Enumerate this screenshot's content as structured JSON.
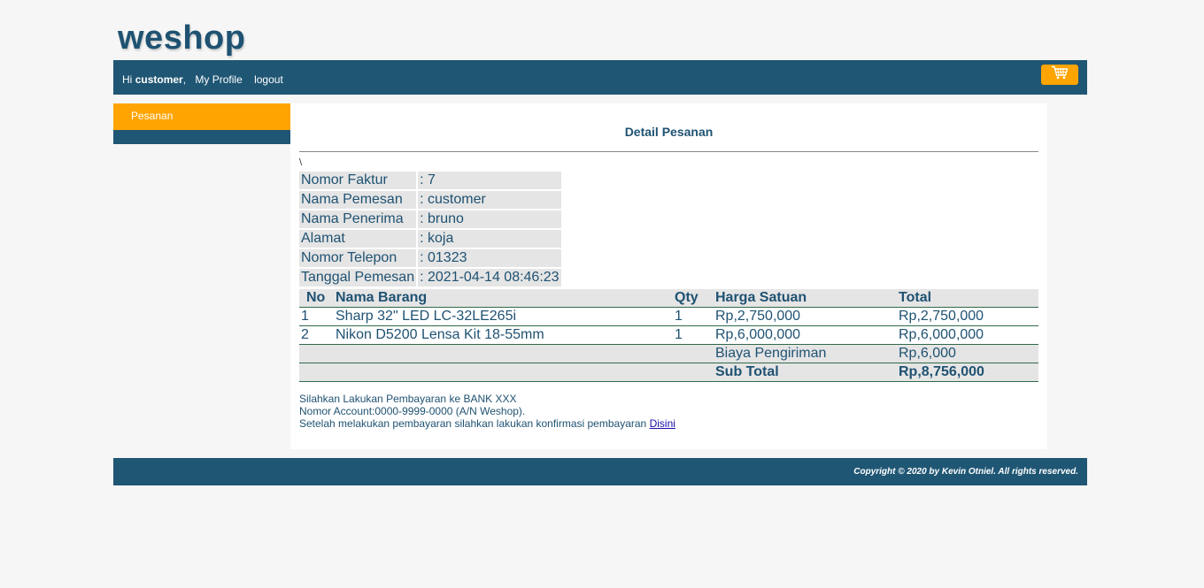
{
  "brand": {
    "logo": "weshop"
  },
  "nav": {
    "greeting_prefix": "Hi",
    "username": "customer",
    "separator": ",",
    "profile_link": "My Profile",
    "logout_link": "logout",
    "cart_icon": "shopping-cart-icon"
  },
  "sidebar": {
    "items": [
      {
        "label": "Pesanan"
      }
    ]
  },
  "main": {
    "title": "Detail Pesanan",
    "stray_char": "\\",
    "info": [
      {
        "label": "Nomor Faktur",
        "sep": ":",
        "value": "7"
      },
      {
        "label": "Nama Pemesan",
        "sep": ":",
        "value": "customer"
      },
      {
        "label": "Nama Penerima",
        "sep": ":",
        "value": "bruno"
      },
      {
        "label": "Alamat",
        "sep": ":",
        "value": "koja"
      },
      {
        "label": "Nomor Telepon",
        "sep": ":",
        "value": "01323"
      },
      {
        "label": "Tanggal Pemesan",
        "sep": ":",
        "value": "2021-04-14 08:46:23"
      }
    ],
    "table": {
      "headers": {
        "no": "No",
        "name": "Nama Barang",
        "qty": "Qty",
        "price": "Harga Satuan",
        "total": "Total"
      },
      "rows": [
        {
          "no": "1",
          "name": "Sharp 32\" LED LC-32LE265i",
          "qty": "1",
          "price": "Rp,2,750,000",
          "total": "Rp,2,750,000"
        },
        {
          "no": "2",
          "name": "Nikon D5200 Lensa Kit 18-55mm",
          "qty": "1",
          "price": "Rp,6,000,000",
          "total": "Rp,6,000,000"
        }
      ],
      "shipping_label": "Biaya Pengiriman",
      "shipping_value": "Rp,6,000",
      "subtotal_label": "Sub Total",
      "subtotal_value": "Rp,8,756,000"
    },
    "payment_note": {
      "line1": "Silahkan Lakukan Pembayaran ke BANK XXX",
      "line2": "Nomor Account:0000-9999-0000 (A/N Weshop).",
      "line3": "Setelah melakukan pembayaran silahkan lakukan konfirmasi pembayaran",
      "link": "Disini"
    }
  },
  "footer": {
    "copyright": "Copyright © 2020 by Kevin Otniel. All rights reserved."
  },
  "colors": {
    "primary": "#1f5674",
    "accent": "#ffa400",
    "background": "#f6f6f6"
  }
}
